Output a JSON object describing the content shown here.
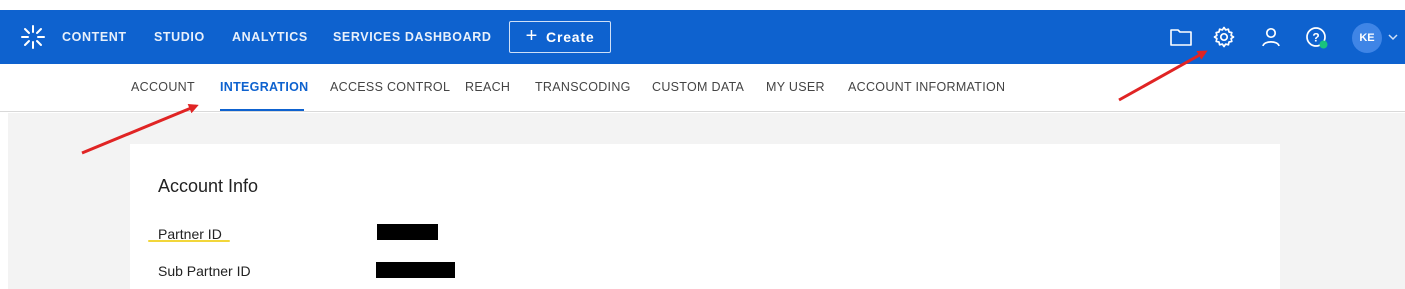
{
  "topbar": {
    "nav": [
      "CONTENT",
      "STUDIO",
      "ANALYTICS",
      "SERVICES DASHBOARD"
    ],
    "create_label": "Create",
    "avatar_initials": "KE",
    "accent": "#0e62cf",
    "status_dot": "#19c37d"
  },
  "subnav": {
    "items": [
      "ACCOUNT",
      "INTEGRATION",
      "ACCESS CONTROL",
      "REACH",
      "TRANSCODING",
      "CUSTOM DATA",
      "MY USER",
      "ACCOUNT INFORMATION"
    ],
    "active": "INTEGRATION"
  },
  "card": {
    "title": "Account Info",
    "fields": [
      {
        "label": "Partner ID"
      },
      {
        "label": "Sub Partner ID"
      }
    ]
  },
  "annotations": {
    "arrow_color": "#e02424",
    "highlight_color": "#f2d63a"
  }
}
